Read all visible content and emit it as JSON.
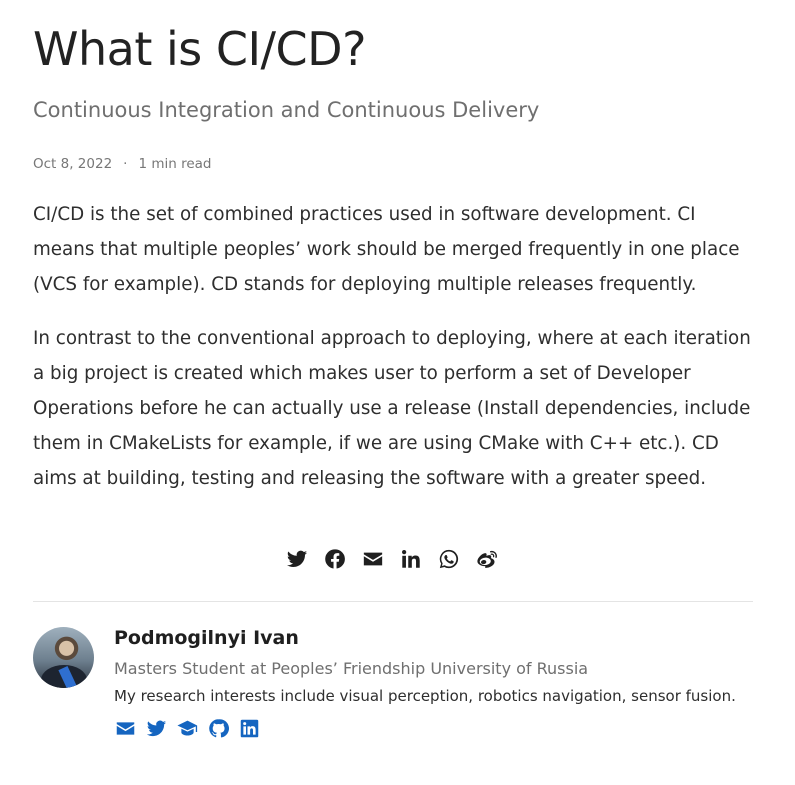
{
  "article": {
    "title": "What is CI/CD?",
    "subtitle": "Continuous Integration and Continuous Delivery",
    "date": "Oct 8, 2022",
    "separator": "·",
    "reading_time": "1 min read",
    "paragraphs": [
      "CI/CD is the set of combined practices used in software development. CI means that multiple peoples’ work should be merged frequently in one place (VCS for example). CD stands for deploying multiple releases frequently.",
      "In contrast to the conventional approach to deploying, where at each iteration a big project is created which makes user to perform a set of Developer Operations before he can actually use a release (Install dependencies, include them in CMakeLists for example, if we are using CMake with C++ etc.). CD aims at building, testing and releasing the software with a greater speed."
    ]
  },
  "share": {
    "icons": [
      "twitter-icon",
      "facebook-icon",
      "email-icon",
      "linkedin-icon",
      "whatsapp-icon",
      "weibo-icon"
    ]
  },
  "author": {
    "name": "Podmogilnyi Ivan",
    "role": "Masters Student at Peoples’ Friendship University of Russia",
    "bio": "My research interests include visual perception, robotics navigation, sensor fusion.",
    "link_icons": [
      "email-icon",
      "twitter-icon",
      "graduation-cap-icon",
      "github-icon",
      "linkedin-icon"
    ],
    "link_color": "#1565c0"
  },
  "colors": {
    "text": "#2e2e2e",
    "muted": "#6f6f6f",
    "accent": "#1565c0"
  }
}
